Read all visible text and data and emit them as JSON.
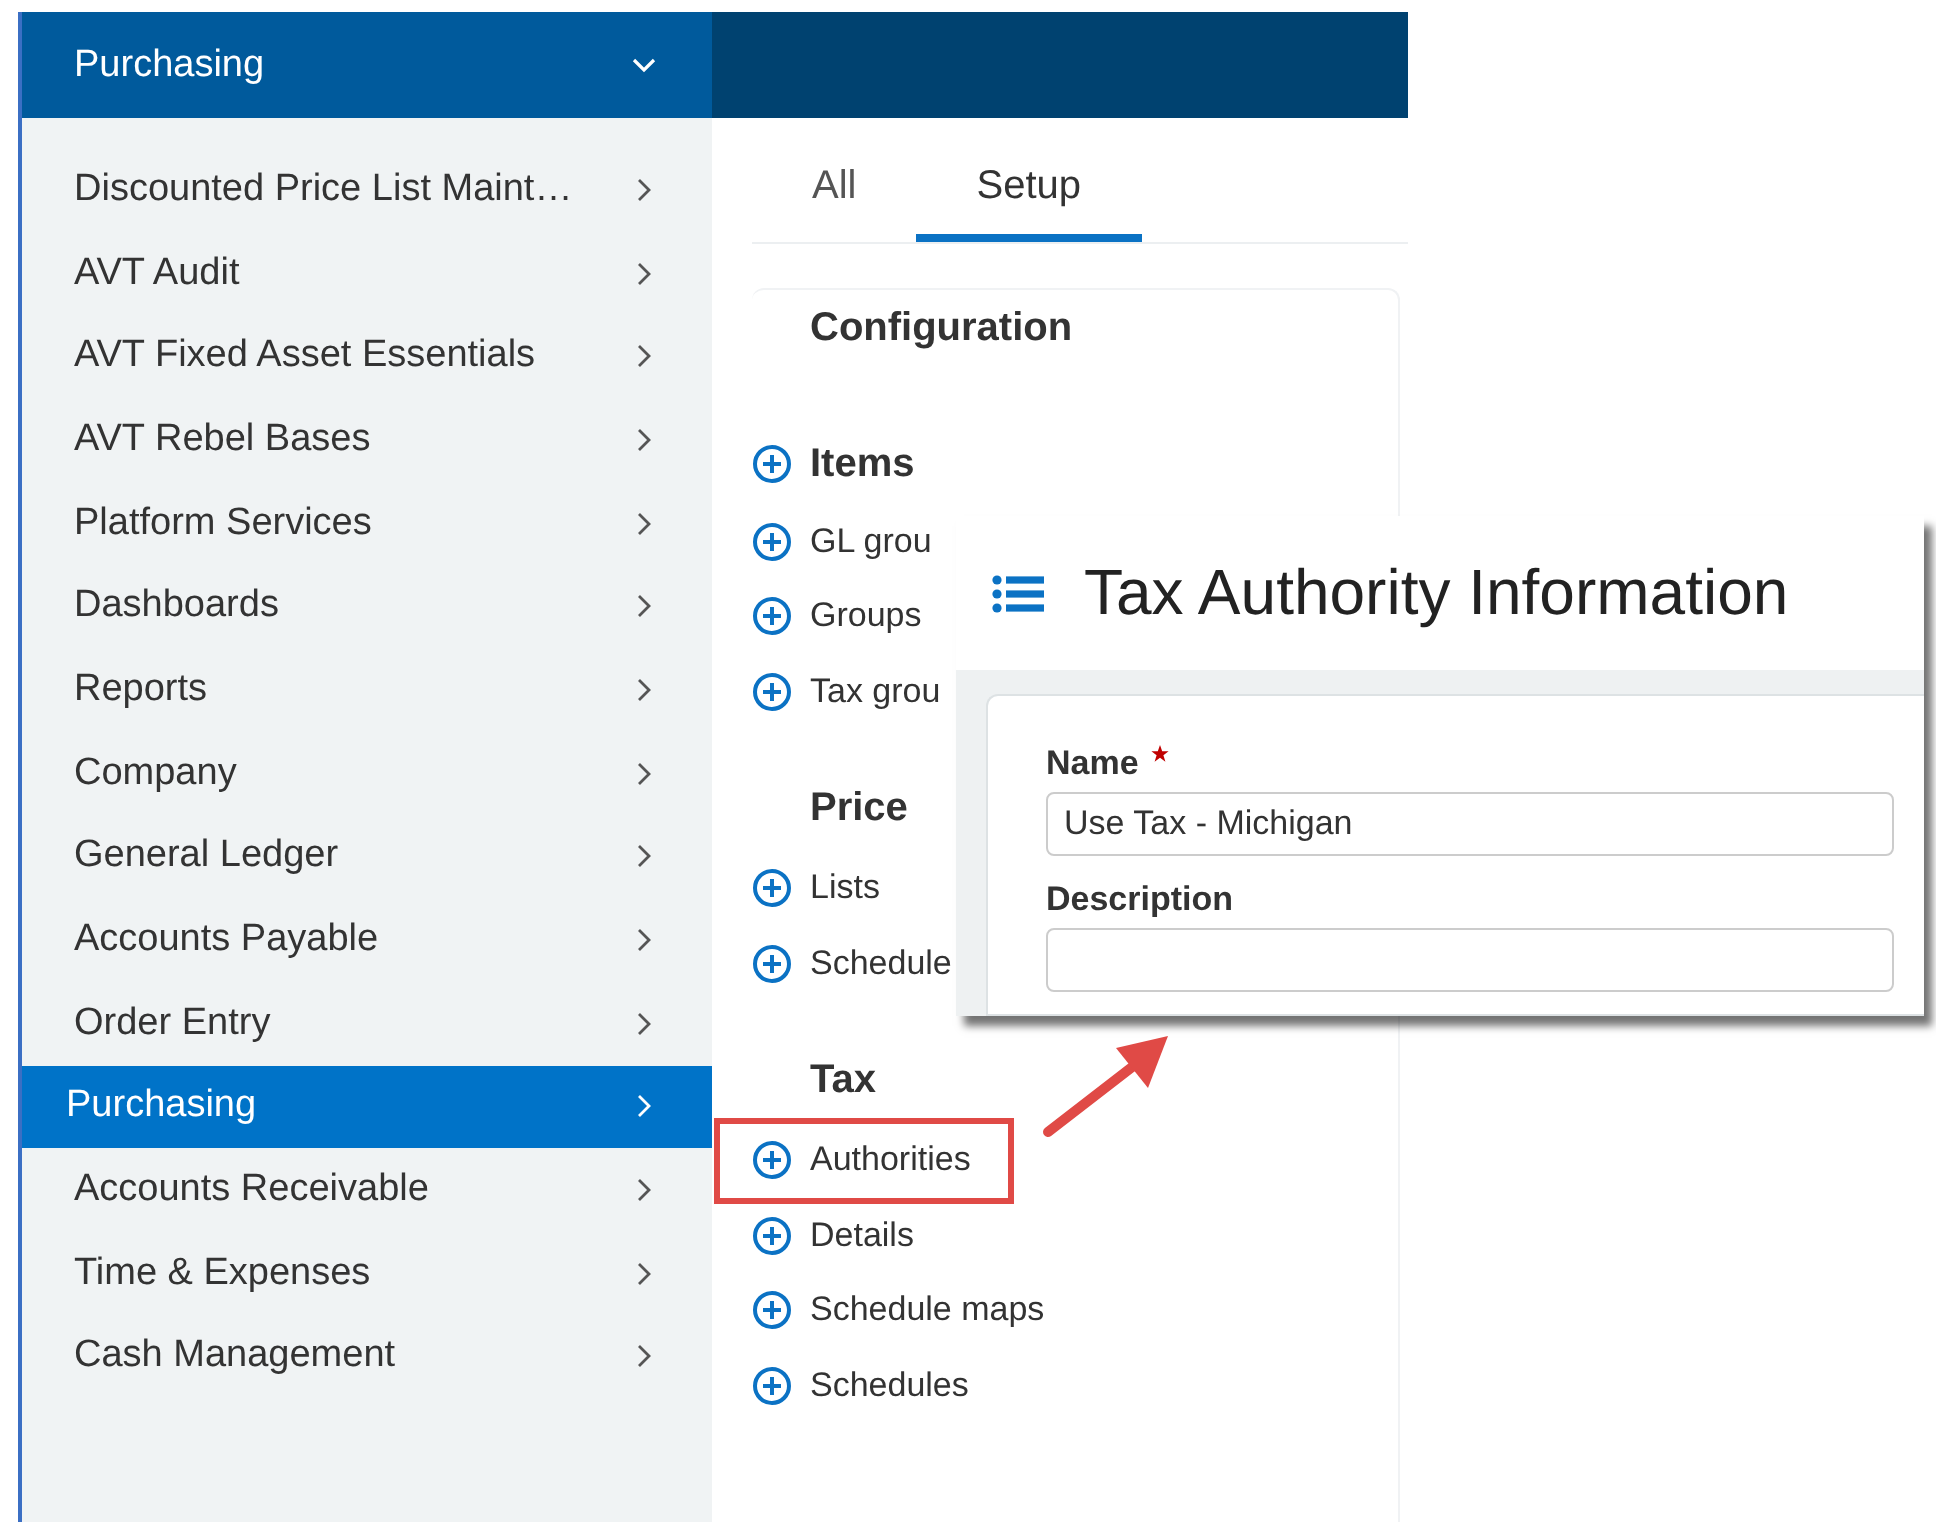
{
  "sidebar": {
    "title": "Purchasing",
    "items": [
      {
        "label": "Discounted Price List Maint…",
        "selected": false
      },
      {
        "label": "AVT Audit",
        "selected": false
      },
      {
        "label": "AVT Fixed Asset Essentials",
        "selected": false
      },
      {
        "label": "AVT Rebel Bases",
        "selected": false
      },
      {
        "label": "Platform Services",
        "selected": false
      },
      {
        "label": "Dashboards",
        "selected": false
      },
      {
        "label": "Reports",
        "selected": false
      },
      {
        "label": "Company",
        "selected": false
      },
      {
        "label": "General Ledger",
        "selected": false
      },
      {
        "label": "Accounts Payable",
        "selected": false
      },
      {
        "label": "Order Entry",
        "selected": false
      },
      {
        "label": "Purchasing",
        "selected": true
      },
      {
        "label": "Accounts Receivable",
        "selected": false
      },
      {
        "label": "Time & Expenses",
        "selected": false
      },
      {
        "label": "Cash Management",
        "selected": false
      }
    ]
  },
  "tabs": [
    {
      "label": "All",
      "selected": false
    },
    {
      "label": "Setup",
      "selected": true
    }
  ],
  "sections": [
    {
      "title": "Configuration",
      "items": [
        {
          "label": "Items",
          "kind": "heading",
          "highlighted": false
        },
        {
          "label": "GL grou",
          "kind": "link",
          "highlighted": false
        },
        {
          "label": "Groups",
          "kind": "link",
          "highlighted": false
        },
        {
          "label": "Tax grou",
          "kind": "link",
          "highlighted": false
        }
      ]
    },
    {
      "title": "Price",
      "items": [
        {
          "label": "Lists",
          "kind": "link",
          "highlighted": false
        },
        {
          "label": "Schedule",
          "kind": "link",
          "highlighted": false
        }
      ]
    },
    {
      "title": "Tax",
      "items": [
        {
          "label": "Authorities",
          "kind": "link",
          "highlighted": true
        },
        {
          "label": "Details",
          "kind": "link",
          "highlighted": false
        },
        {
          "label": "Schedule maps",
          "kind": "link",
          "highlighted": false
        },
        {
          "label": "Schedules",
          "kind": "link",
          "highlighted": false
        }
      ]
    }
  ],
  "popup": {
    "title": "Tax Authority Information",
    "fields": [
      {
        "label": "Name",
        "required": true,
        "value": "Use Tax - Michigan"
      },
      {
        "label": "Description",
        "required": false
      }
    ]
  }
}
